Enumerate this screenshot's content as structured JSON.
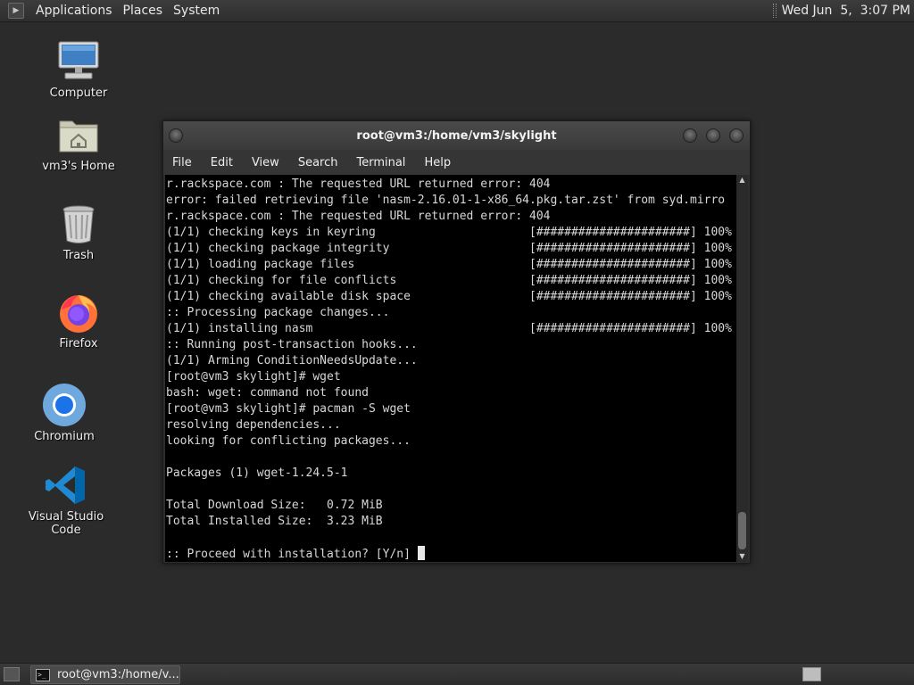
{
  "top_panel": {
    "menus": [
      "Applications",
      "Places",
      "System"
    ],
    "clock": "Wed Jun  5,  3:07 PM"
  },
  "desktop_icons": [
    {
      "label": "Computer",
      "icon": "computer-icon"
    },
    {
      "label": "vm3's Home",
      "icon": "home-folder-icon"
    },
    {
      "label": "Trash",
      "icon": "trash-icon"
    },
    {
      "label": "Firefox",
      "icon": "firefox-icon"
    },
    {
      "label": "Chromium",
      "icon": "chromium-icon"
    },
    {
      "label": "Visual Studio Code",
      "icon": "vscode-icon"
    }
  ],
  "terminal": {
    "title": "root@vm3:/home/vm3/skylight",
    "menu": [
      "File",
      "Edit",
      "View",
      "Search",
      "Terminal",
      "Help"
    ],
    "lines": [
      "r.rackspace.com : The requested URL returned error: 404",
      "error: failed retrieving file 'nasm-2.16.01-1-x86_64.pkg.tar.zst' from syd.mirro",
      "r.rackspace.com : The requested URL returned error: 404",
      "(1/1) checking keys in keyring                      [######################] 100%",
      "(1/1) checking package integrity                    [######################] 100%",
      "(1/1) loading package files                         [######################] 100%",
      "(1/1) checking for file conflicts                   [######################] 100%",
      "(1/1) checking available disk space                 [######################] 100%",
      ":: Processing package changes...",
      "(1/1) installing nasm                               [######################] 100%",
      ":: Running post-transaction hooks...",
      "(1/1) Arming ConditionNeedsUpdate...",
      "[root@vm3 skylight]# wget",
      "bash: wget: command not found",
      "[root@vm3 skylight]# pacman -S wget",
      "resolving dependencies...",
      "looking for conflicting packages...",
      "",
      "Packages (1) wget-1.24.5-1",
      "",
      "Total Download Size:   0.72 MiB",
      "Total Installed Size:  3.23 MiB",
      "",
      ":: Proceed with installation? [Y/n] "
    ]
  },
  "taskbar": {
    "task_label": "root@vm3:/home/v..."
  },
  "colors": {
    "desktop": "#2b2b2b",
    "terminal_bg": "#000000",
    "terminal_fg": "#d7d7d7"
  }
}
